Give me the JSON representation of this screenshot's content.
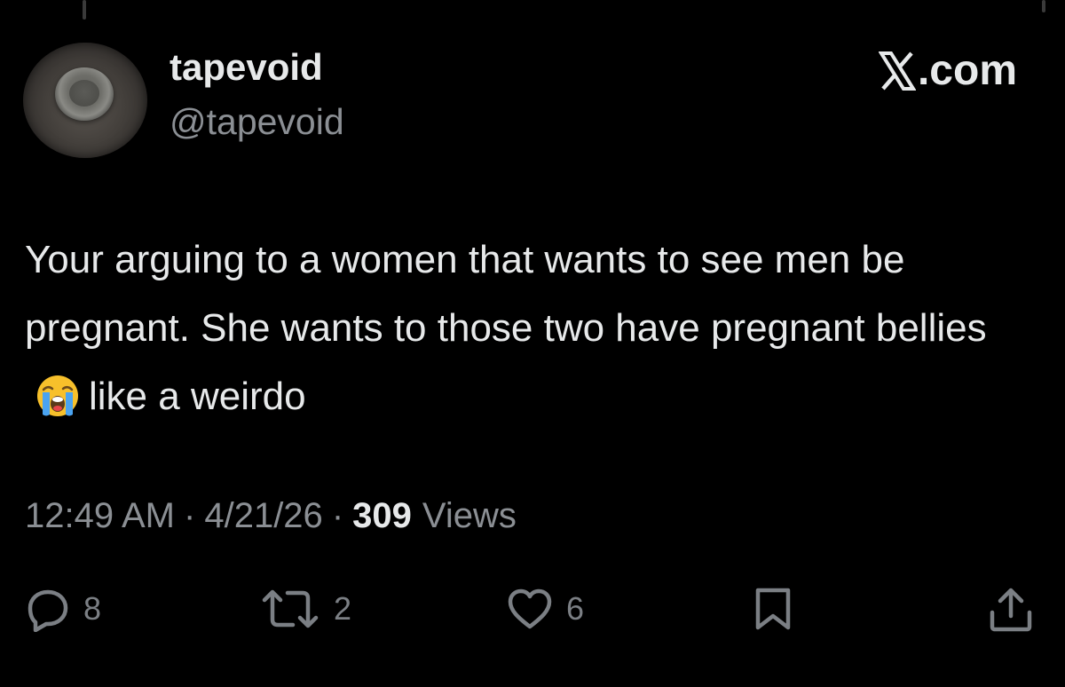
{
  "author": {
    "display_name": "tapevoid",
    "handle": "@tapevoid"
  },
  "brand": {
    "label": ".com",
    "icon": "x-logo-icon"
  },
  "tweet": {
    "text_before_emoji": "Your arguing to a women that wants to see men be pregnant. She wants to those two have pregnant bellies",
    "emoji": "loudly-crying-face-emoji",
    "text_after_emoji": "like a weirdo"
  },
  "meta": {
    "time": "12:49 AM",
    "separator": "·",
    "date": "4/21/26",
    "views_count": "309",
    "views_label": "Views"
  },
  "actions": {
    "replies": {
      "icon": "reply-icon",
      "count": "8"
    },
    "reposts": {
      "icon": "repost-icon",
      "count": "2"
    },
    "likes": {
      "icon": "heart-icon",
      "count": "6"
    },
    "bookmark": {
      "icon": "bookmark-icon"
    },
    "share": {
      "icon": "share-icon"
    }
  },
  "colors": {
    "background": "#000000",
    "primary_text": "#e7e9ea",
    "secondary_text": "#8b8f94",
    "icon_gray": "#7b7f84"
  }
}
